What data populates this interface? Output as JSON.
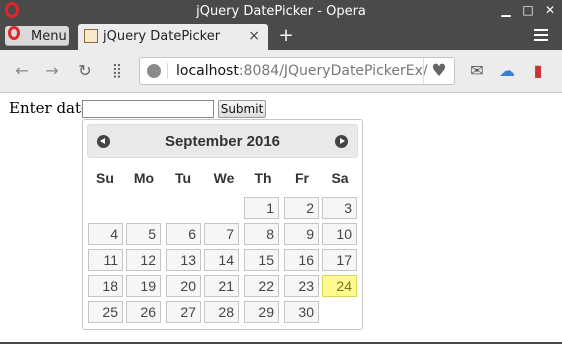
{
  "window": {
    "title": "jQuery DatePicker - Opera"
  },
  "browser": {
    "menu_label": "Menu",
    "tab_title": "jQuery DatePicker",
    "tab_close": "×",
    "new_tab": "+",
    "url_host": "localhost",
    "url_rest": ":8084/JQueryDatePickerEx/"
  },
  "form": {
    "label": "Enter date:",
    "input_value": "",
    "submit_label": "Submit"
  },
  "datepicker": {
    "title": "September 2016",
    "weekdays": [
      "Su",
      "Mo",
      "Tu",
      "We",
      "Th",
      "Fr",
      "Sa"
    ],
    "today": 24,
    "weeks": [
      [
        "",
        "",
        "",
        "",
        "1",
        "2",
        "3"
      ],
      [
        "4",
        "5",
        "6",
        "7",
        "8",
        "9",
        "10"
      ],
      [
        "11",
        "12",
        "13",
        "14",
        "15",
        "16",
        "17"
      ],
      [
        "18",
        "19",
        "20",
        "21",
        "22",
        "23",
        "24"
      ],
      [
        "25",
        "26",
        "27",
        "28",
        "29",
        "30",
        ""
      ]
    ]
  },
  "colors": {
    "today_bg": "#fffa90",
    "opera_red": "#e0262b",
    "chrome": "#4a4a4a"
  },
  "icons": [
    "opera-logo",
    "back-icon",
    "forward-icon",
    "reload-icon",
    "speed-dial-icon",
    "site-info-icon",
    "heart-icon",
    "mail-icon",
    "cloud-icon",
    "extension-icon",
    "tab-menu-icon"
  ]
}
